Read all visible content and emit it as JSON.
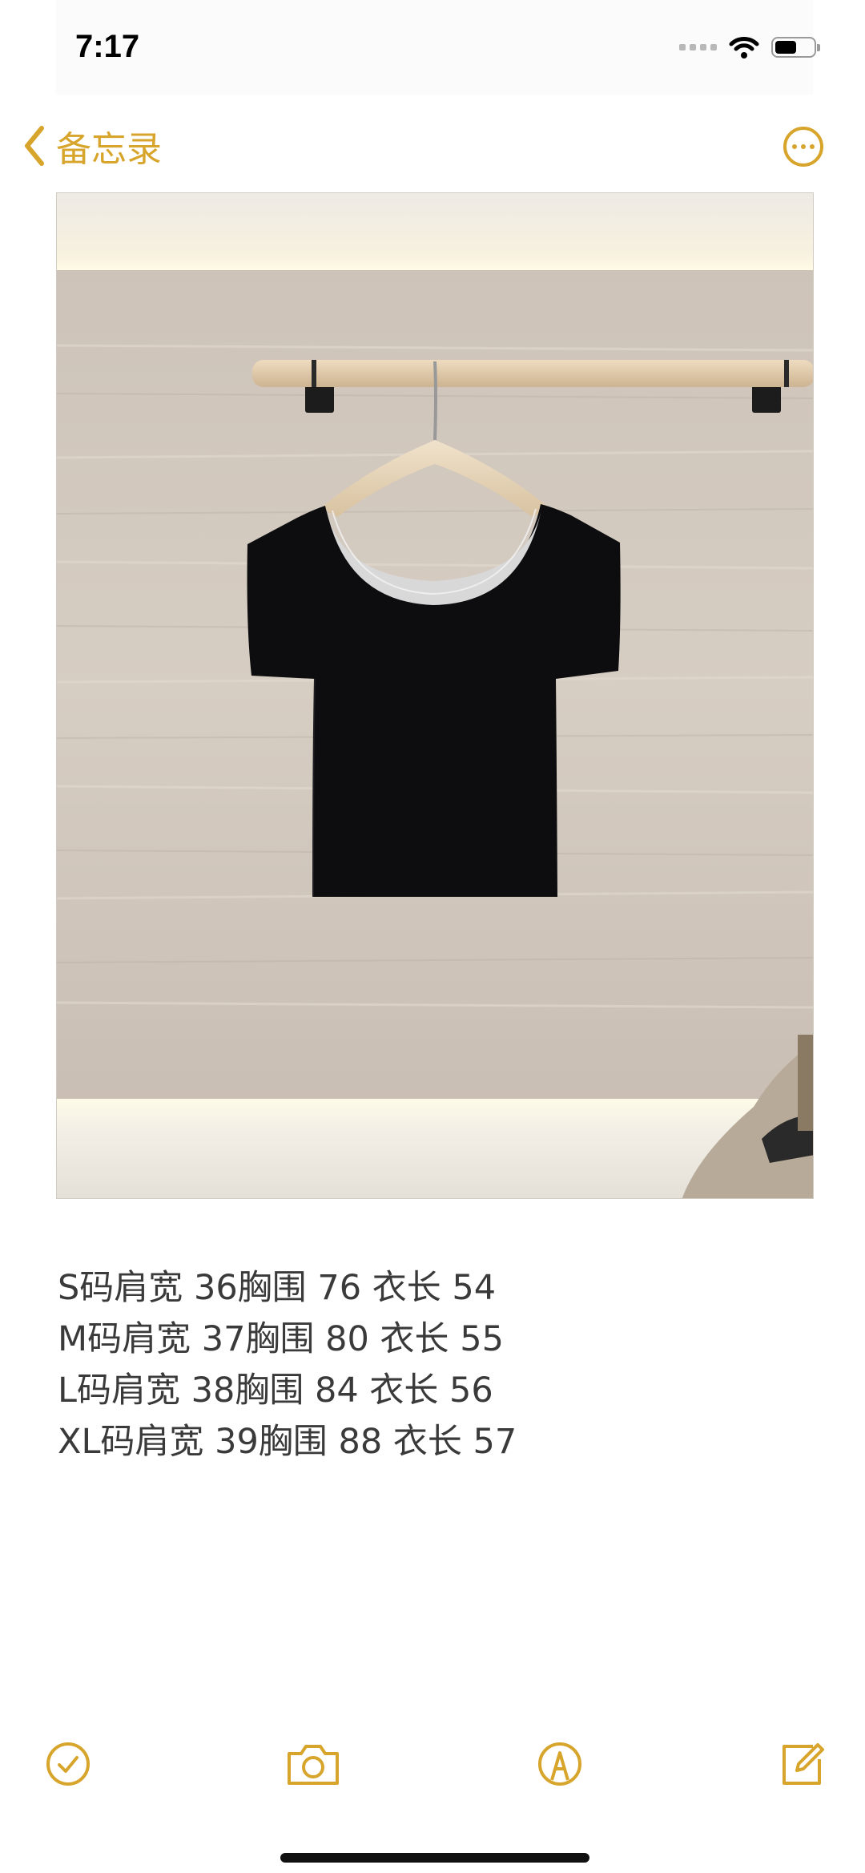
{
  "status_bar": {
    "time": "7:17"
  },
  "nav": {
    "back_label": "备忘录",
    "back_icon": "chevron-left-icon",
    "more_icon": "ellipsis-circle-icon"
  },
  "photo": {
    "subject": "black-tshirt-on-hanger"
  },
  "note": {
    "lines": [
      "S码肩宽 36胸围 76 衣长 54",
      "M码肩宽 37胸围 80 衣长 55",
      "L码肩宽 38胸围 84 衣长 56",
      "XL码肩宽 39胸围 88 衣长 57"
    ]
  },
  "toolbar": {
    "checklist_icon": "checklist-icon",
    "camera_icon": "camera-icon",
    "markup_icon": "markup-pen-icon",
    "compose_icon": "compose-icon"
  },
  "colors": {
    "accent": "#d8a52c",
    "text": "#3a3a3a"
  }
}
